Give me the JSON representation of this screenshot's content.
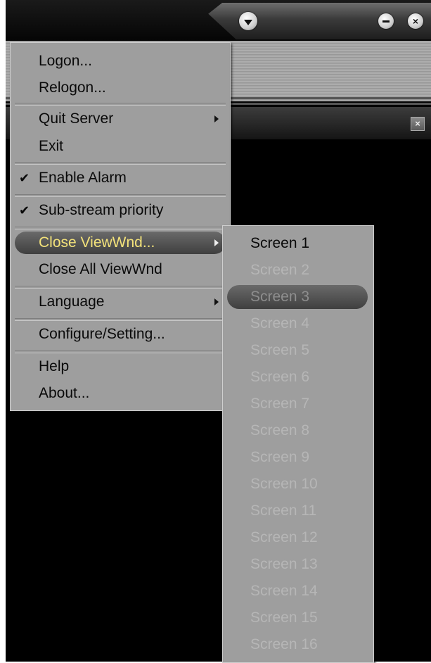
{
  "main_menu": {
    "items": [
      {
        "label": "Logon..."
      },
      {
        "label": "Relogon..."
      },
      {
        "label": "Quit Server"
      },
      {
        "label": "Exit"
      },
      {
        "label": "Enable Alarm",
        "checked": true
      },
      {
        "label": "Sub-stream priority",
        "checked": true
      },
      {
        "label": "Close ViewWnd...",
        "highlighted": true
      },
      {
        "label": "Close All ViewWnd"
      },
      {
        "label": "Language"
      },
      {
        "label": "Configure/Setting..."
      },
      {
        "label": "Help"
      },
      {
        "label": "About..."
      }
    ],
    "check_glyph": "✔"
  },
  "submenu": {
    "items": [
      {
        "label": "Screen 1",
        "enabled": true
      },
      {
        "label": "Screen 2",
        "enabled": false
      },
      {
        "label": "Screen 3",
        "enabled": false,
        "highlighted": true
      },
      {
        "label": "Screen 4",
        "enabled": false
      },
      {
        "label": "Screen 5",
        "enabled": false
      },
      {
        "label": "Screen 6",
        "enabled": false
      },
      {
        "label": "Screen 7",
        "enabled": false
      },
      {
        "label": "Screen 8",
        "enabled": false
      },
      {
        "label": "Screen 9",
        "enabled": false
      },
      {
        "label": "Screen 10",
        "enabled": false
      },
      {
        "label": "Screen 11",
        "enabled": false
      },
      {
        "label": "Screen 12",
        "enabled": false
      },
      {
        "label": "Screen 13",
        "enabled": false
      },
      {
        "label": "Screen 14",
        "enabled": false
      },
      {
        "label": "Screen 15",
        "enabled": false
      },
      {
        "label": "Screen 16",
        "enabled": false
      }
    ]
  },
  "colors": {
    "menu_bg": "#9e9e9e",
    "highlight_text": "#f3e27a",
    "disabled_text": "#b6b6b6",
    "window_bg": "#000000"
  },
  "icons": {
    "title_menu": "chevron-down-icon",
    "minimize": "minimize-icon",
    "close": "close-icon",
    "panel_close": "close-icon",
    "submenu_arrow": "chevron-right-icon",
    "check": "checkmark-icon"
  }
}
